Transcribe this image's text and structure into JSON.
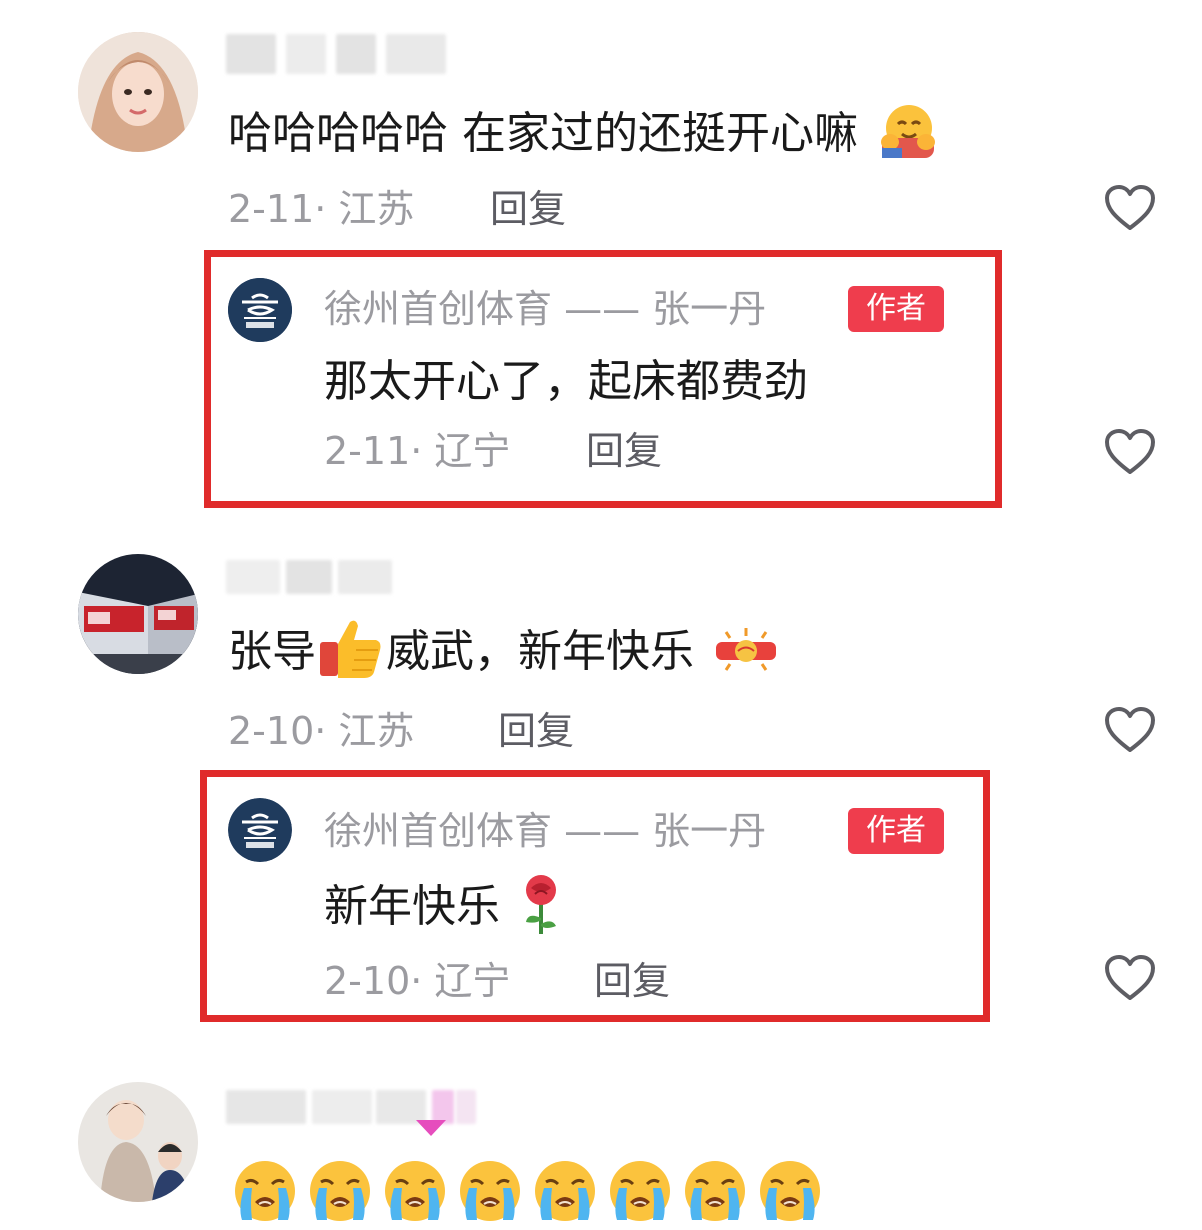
{
  "comments": [
    {
      "text": "哈哈哈哈哈 在家过的还挺开心嘛",
      "meta": "2-11· 江苏",
      "reply_label": "回复",
      "author_reply": {
        "name": "徐州首创体育 —— 张一丹",
        "badge": "作者",
        "text": "那太开心了，起床都费劲",
        "meta": "2-11· 辽宁",
        "reply_label": "回复"
      }
    },
    {
      "text_part1": "张导",
      "text_part2": "威武，新年快乐",
      "meta": "2-10· 江苏",
      "reply_label": "回复",
      "author_reply": {
        "name": "徐州首创体育 —— 张一丹",
        "badge": "作者",
        "text": "新年快乐",
        "meta": "2-10· 辽宁",
        "reply_label": "回复"
      }
    }
  ],
  "colors": {
    "highlight_box": "#e02b2b",
    "author_badge": "#ef3d4d",
    "meta_text": "#9b9ba0"
  },
  "icons": {
    "like": "heart-outline-icon",
    "hug": "hugging-face-emoji",
    "thumbs_up": "thumbs-up-emoji",
    "firecracker": "firecracker-emoji",
    "rose": "rose-emoji",
    "crying": "loudly-crying-face-emoji"
  },
  "crying_count": 8
}
